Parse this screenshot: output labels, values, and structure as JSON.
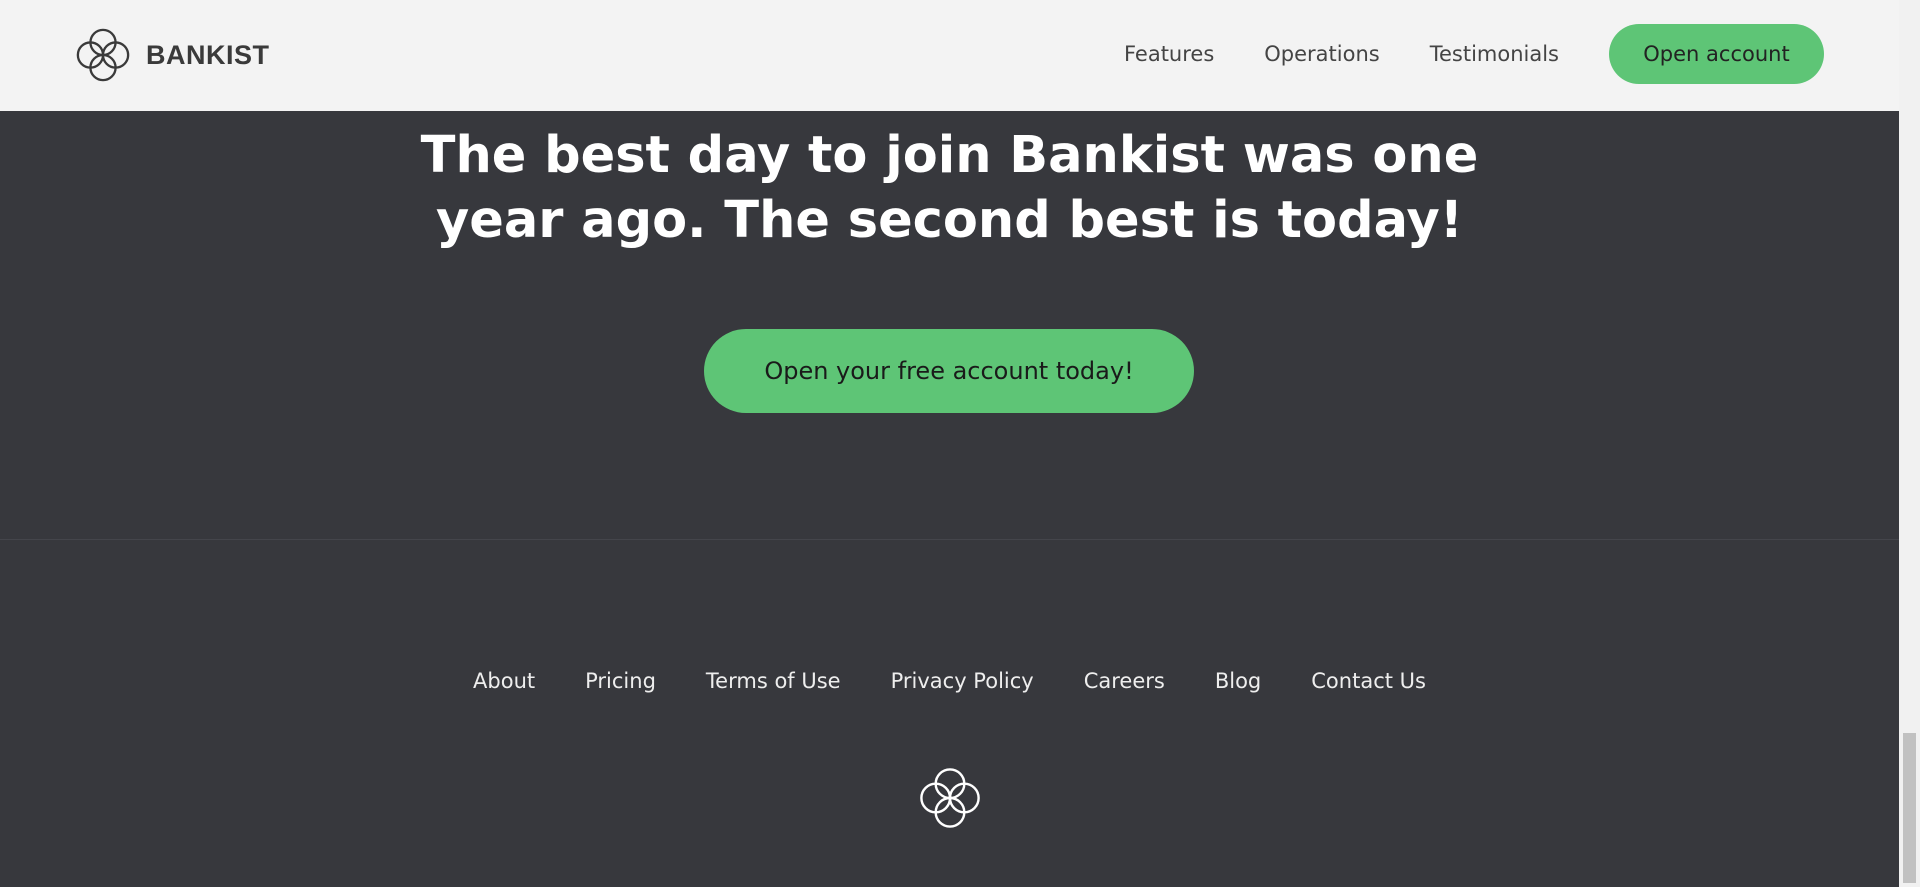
{
  "header": {
    "brand": {
      "name": "BANKIST",
      "logo_icon": "four-circles-logo-icon"
    },
    "nav": {
      "links": [
        "Features",
        "Operations",
        "Testimonials"
      ],
      "cta_label": "Open account"
    }
  },
  "signup": {
    "title_line1": "The best day to join Bankist was one",
    "title_line2": "year ago. The second best is today!",
    "button_label": "Open your free account today!"
  },
  "footer": {
    "links": [
      "About",
      "Pricing",
      "Terms of Use",
      "Privacy Policy",
      "Careers",
      "Blog",
      "Contact Us"
    ],
    "logo_icon": "four-circles-logo-icon"
  },
  "colors": {
    "accent_green": "#5ec576",
    "dark_background": "#37383d",
    "header_background": "#f3f3f3"
  }
}
